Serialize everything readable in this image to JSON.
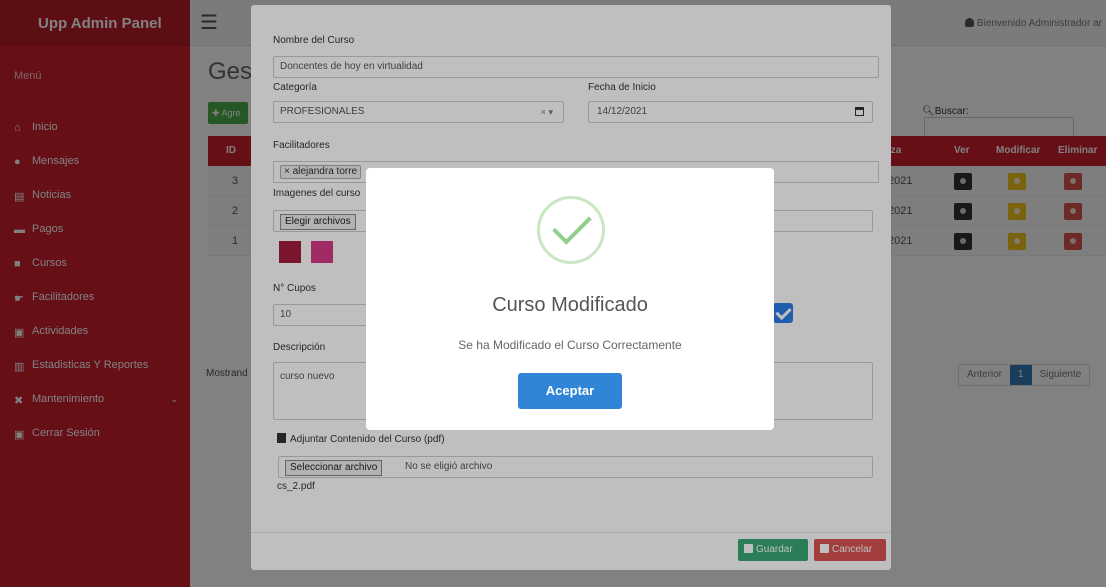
{
  "sidebar": {
    "brand": "Upp Admin Panel",
    "menu_header": "Menú",
    "items": [
      {
        "label": "Inicio",
        "icon": "home-icon"
      },
      {
        "label": "Mensajes",
        "icon": "comment-icon"
      },
      {
        "label": "Noticias",
        "icon": "newspaper-icon"
      },
      {
        "label": "Pagos",
        "icon": "money-icon"
      },
      {
        "label": "Cursos",
        "icon": "book-icon"
      },
      {
        "label": "Facilitadores",
        "icon": "hand-icon"
      },
      {
        "label": "Actividades",
        "icon": "image-icon"
      },
      {
        "label": "Estadisticas Y Reportes",
        "icon": "chart-icon"
      },
      {
        "label": "Mantenimiento",
        "icon": "tools-icon"
      },
      {
        "label": "Cerrar Sesión",
        "icon": "logout-icon"
      }
    ]
  },
  "topbar": {
    "welcome": "Bienvenido Administrador ar"
  },
  "background": {
    "title": "Gest",
    "add_button": "Agre",
    "search_label": "Buscar:",
    "columns": {
      "id": "ID",
      "date": "iza",
      "view": "Ver",
      "modify": "Modificar",
      "delete": "Eliminar"
    },
    "rows": [
      {
        "id": "3",
        "date": "2021"
      },
      {
        "id": "2",
        "date": "2021"
      },
      {
        "id": "1",
        "date": "2021"
      }
    ],
    "showing": "Mostrand",
    "pager": {
      "prev": "Anterior",
      "current": "1",
      "next": "Siguiente"
    }
  },
  "modal": {
    "name_label": "Nombre del Curso",
    "name_value": "Doncentes de hoy en virtualidad",
    "category_label": "Categoría",
    "category_value": "PROFESIONALES",
    "category_clear": "× ▾",
    "start_label": "Fecha de Inicio",
    "start_value": "14/12/2021",
    "facilitators_label": "Facilitadores",
    "facilitator_tag": "× alejandra torre",
    "images_label": "Imagenes del curso",
    "images_button": "Elegir archivos",
    "slots_label": "N° Cupos",
    "slots_value": "10",
    "description_label": "Descripción",
    "description_value": "curso nuevo",
    "pdf_label": "Adjuntar Contenido del Curso (pdf)",
    "pdf_button": "Seleccionar archivo",
    "pdf_status": "No se eligió archivo",
    "pdf_current": "cs_2.pdf",
    "save_button": "Guardar",
    "cancel_button": "Cancelar"
  },
  "alert": {
    "title": "Curso Modificado",
    "text": "Se ha Modificado el Curso Correctamente",
    "confirm": "Aceptar"
  },
  "colors": {
    "sidebar": "#c9202e",
    "table_header": "#c9202e",
    "success_green": "#8fd18c",
    "confirm_blue": "#3085d6",
    "save_green": "#3aa776",
    "cancel_red": "#d9534f"
  }
}
